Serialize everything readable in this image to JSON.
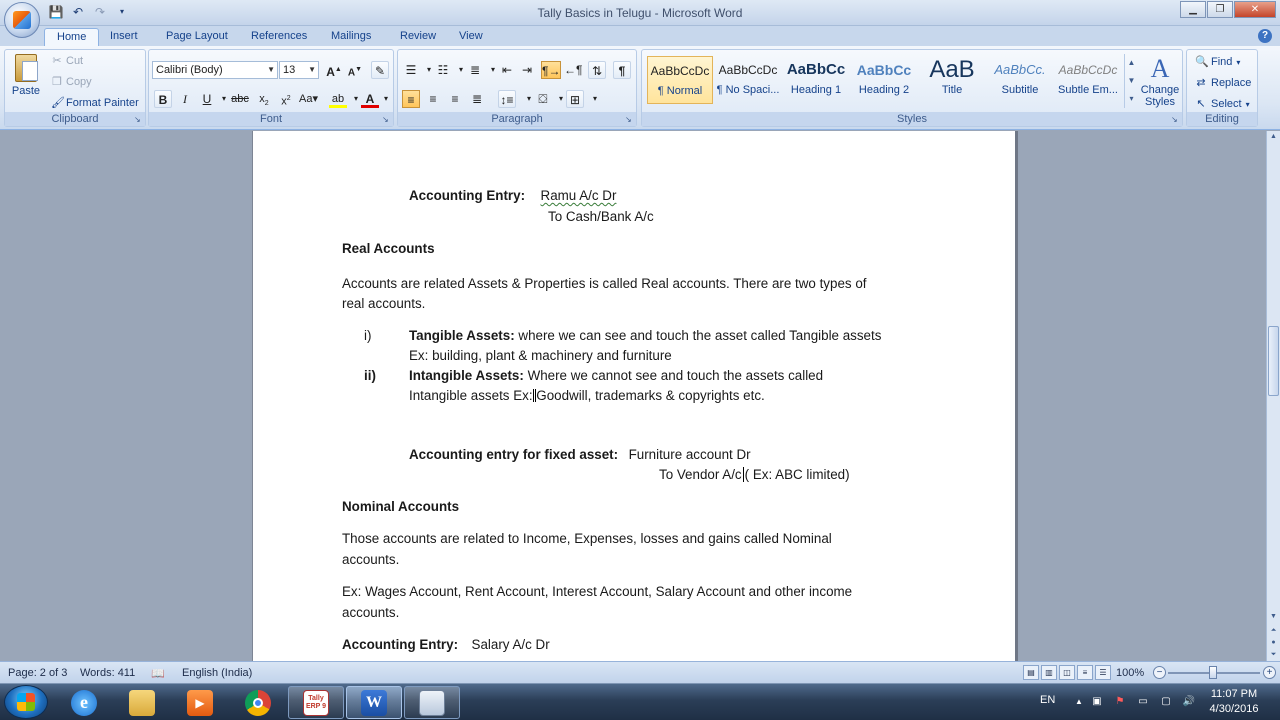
{
  "window": {
    "title": "Tally Basics in Telugu - Microsoft Word",
    "minimize": "▁",
    "maximize": "❐",
    "close": "✕"
  },
  "tabs": [
    "Home",
    "Insert",
    "Page Layout",
    "References",
    "Mailings",
    "Review",
    "View"
  ],
  "ribbon": {
    "clipboard": {
      "label": "Clipboard",
      "paste": "Paste",
      "cut": "Cut",
      "copy": "Copy",
      "format_painter": "Format Painter"
    },
    "font": {
      "label": "Font",
      "font_name": "Calibri (Body)",
      "font_size": "13"
    },
    "paragraph": {
      "label": "Paragraph"
    },
    "styles": {
      "label": "Styles",
      "items": [
        {
          "sample": "AaBbCcDc",
          "name": "¶ Normal"
        },
        {
          "sample": "AaBbCcDc",
          "name": "¶ No Spaci..."
        },
        {
          "sample": "AaBbCc",
          "name": "Heading 1"
        },
        {
          "sample": "AaBbCc",
          "name": "Heading 2"
        },
        {
          "sample": "AaB",
          "name": "Title"
        },
        {
          "sample": "AaBbCc.",
          "name": "Subtitle"
        },
        {
          "sample": "AaBbCcDc",
          "name": "Subtle Em..."
        }
      ],
      "change_styles": "Change Styles"
    },
    "editing": {
      "label": "Editing",
      "find": "Find",
      "replace": "Replace",
      "select": "Select"
    }
  },
  "document": {
    "entry1_label": "Accounting Entry:",
    "entry1_debit": "Ramu A/c  Dr",
    "entry1_credit": "To Cash/Bank A/c",
    "real_heading": "Real Accounts",
    "real_text_1": "Accounts are related Assets & Properties is called Real accounts. There are two types of",
    "real_text_2": "real accounts.",
    "item1_num": "i)",
    "item1_title": "Tangible Assets:",
    "item1_text": " where we can see and touch the asset called Tangible assets",
    "item1_ex": "Ex: building, plant & machinery and furniture",
    "item2_num": "ii)",
    "item2_title": "Intangible Assets:",
    "item2_text": " Where we cannot see and touch the assets called",
    "item2_ex": "Intangible assets Ex: Goodwill, trademarks & copyrights etc.",
    "entry2_label": "Accounting  entry for fixed asset:",
    "entry2_debit": "Furniture account Dr",
    "entry2_credit_a": "To Vendor A/c",
    "entry2_credit_b": "( Ex: ABC limited)",
    "nominal_heading": "Nominal Accounts",
    "nominal_text_1": "Those accounts are related to Income, Expenses, losses and gains called Nominal",
    "nominal_text_2": "accounts.",
    "nominal_ex_1": "Ex: Wages Account, Rent Account, Interest Account, Salary Account and other income",
    "nominal_ex_2": "accounts.",
    "entry3_label": "Accounting Entry:",
    "entry3_debit": "Salary A/c Dr"
  },
  "status": {
    "page": "Page: 2 of 3",
    "words": "Words: 411",
    "language": "English (India)",
    "zoom": "100%"
  },
  "taskbar": {
    "tally_label": "Tally ERP 9",
    "word_label": "W",
    "tray_lang": "EN",
    "time": "11:07 PM",
    "date": "4/30/2016"
  }
}
